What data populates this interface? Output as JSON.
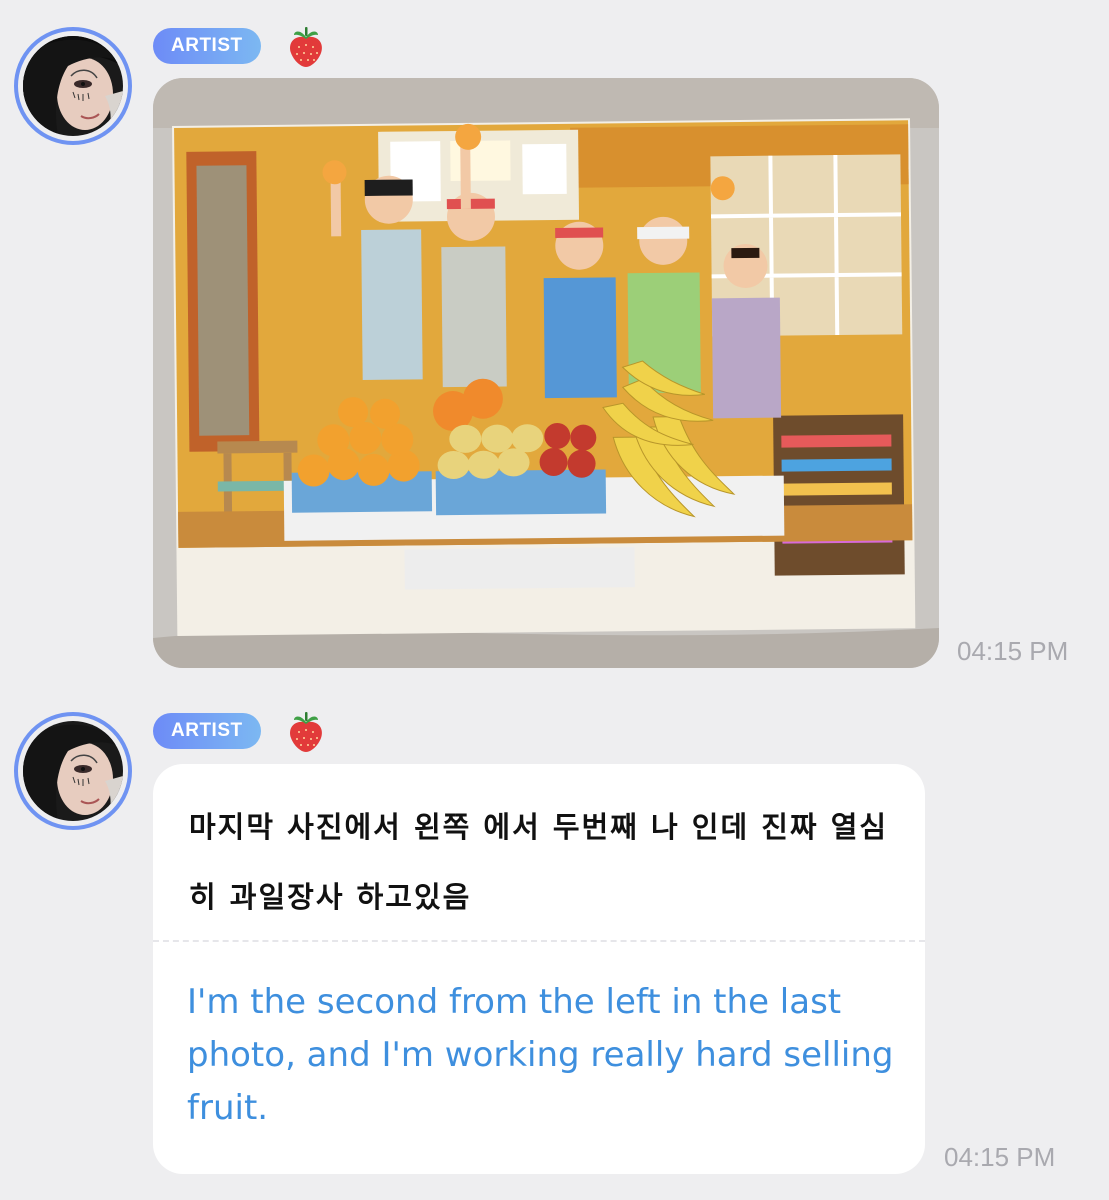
{
  "messages": [
    {
      "badge": "ARTIST",
      "badge_icon": "strawberry-icon",
      "type": "photo",
      "timestamp": "04:15 PM"
    },
    {
      "badge": "ARTIST",
      "badge_icon": "strawberry-icon",
      "type": "text",
      "original": "마지막 사진에서 왼쪽 에서 두번째 나 인데 진짜 열심히 과일장사 하고있음",
      "translation": "I'm the second from the left in the last photo, and I'm working really hard selling fruit.",
      "timestamp": "04:15 PM"
    }
  ],
  "colors": {
    "background": "#eeeef0",
    "badge_start": "#6d8bf7",
    "badge_end": "#7cb8f2",
    "avatar_ring": "#6f93f2",
    "translation_text": "#3e8fde",
    "timestamp": "#a9a9af"
  }
}
